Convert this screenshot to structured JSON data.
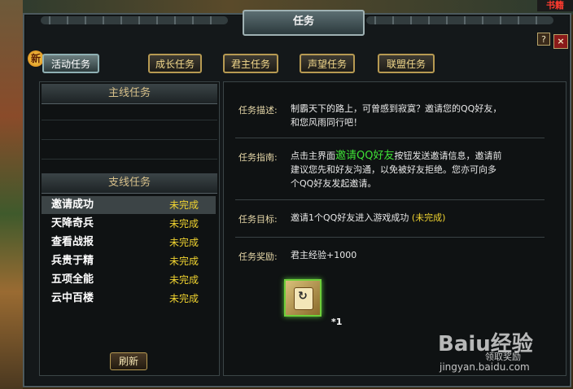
{
  "corner_tag": "书籍",
  "window": {
    "title": "任务",
    "help_label": "?",
    "close_label": "×"
  },
  "colors": {
    "frame": "#4d5a5e",
    "gold_text": "#f2d88b",
    "status_yellow": "#f1d430",
    "highlight_green": "#3ee035"
  },
  "new_badge": "新",
  "tabs": [
    {
      "label": "活动任务",
      "active": true
    },
    {
      "label": "成长任务",
      "active": false
    },
    {
      "label": "君主任务",
      "active": false
    },
    {
      "label": "声望任务",
      "active": false
    },
    {
      "label": "联盟任务",
      "active": false
    }
  ],
  "main_quests": {
    "header": "主线任务"
  },
  "side_quests": {
    "header": "支线任务",
    "items": [
      {
        "name": "邀请成功",
        "status": "未完成",
        "selected": true
      },
      {
        "name": "天降奇兵",
        "status": "未完成"
      },
      {
        "name": "查看战报",
        "status": "未完成"
      },
      {
        "name": "兵贵于精",
        "status": "未完成"
      },
      {
        "name": "五项全能",
        "status": "未完成"
      },
      {
        "name": "云中百楼",
        "status": "未完成"
      }
    ]
  },
  "refresh_label": "刷新",
  "detail": {
    "description_label": "任务描述:",
    "description_line1": "制霸天下的路上，可曾感到寂寞？邀请您的QQ好友，",
    "description_line2": "和您风雨同行吧！",
    "guide_label": "任务指南:",
    "guide_pre": "点击主界面",
    "guide_highlight": "邀请QQ好友",
    "guide_post": "按钮发送邀请信息，邀请前",
    "guide_line2": "建议您先和好友沟通，以免被好友拒绝。您亦可向多",
    "guide_line3": "个QQ好友发起邀请。",
    "goal_label": "任务目标:",
    "goal_text": "邀请1个QQ好友进入游戏成功",
    "goal_status": "(未完成)",
    "reward_label": "任务奖励:",
    "reward_text": "君主经验+1000",
    "reward_icon": "scroll-item-icon",
    "reward_count": "*1"
  },
  "watermark": {
    "brand": "Baiu经验",
    "sub": "jingyan.baidu.com",
    "mid": "领取奖励"
  }
}
